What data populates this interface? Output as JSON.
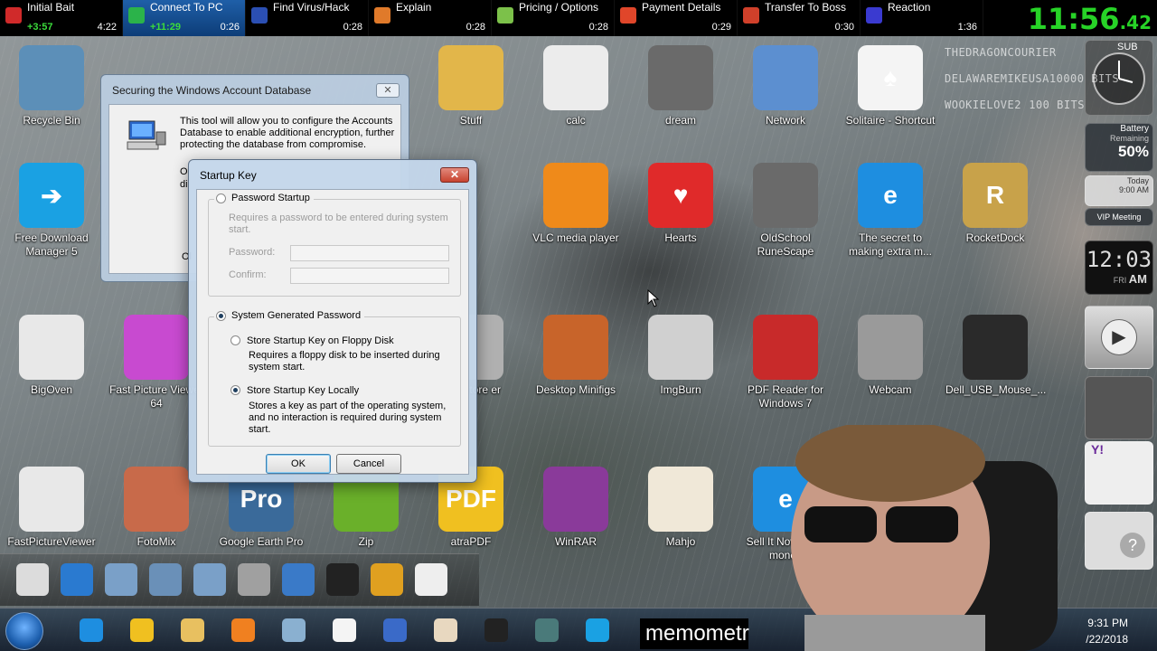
{
  "splits": [
    {
      "name": "Initial Bait",
      "delta": "+3:57",
      "time": "4:22",
      "color": "#d02a2a",
      "active": false
    },
    {
      "name": "Connect To PC",
      "delta": "+11:29",
      "time": "0:26",
      "color": "#2bb34a",
      "active": true
    },
    {
      "name": "Find Virus/Hack",
      "delta": "",
      "time": "0:28",
      "color": "#2b4fb3",
      "active": false
    },
    {
      "name": "Explain",
      "delta": "",
      "time": "0:28",
      "color": "#e07a2a",
      "active": false
    },
    {
      "name": "Pricing / Options",
      "delta": "",
      "time": "0:28",
      "color": "#7cc14a",
      "active": false
    },
    {
      "name": "Payment Details",
      "delta": "",
      "time": "0:29",
      "color": "#e0462a",
      "active": false
    },
    {
      "name": "Transfer To Boss",
      "delta": "",
      "time": "0:30",
      "color": "#d0402a",
      "active": false
    },
    {
      "name": "Reaction",
      "delta": "",
      "time": "1:36",
      "color": "#3a3ad0",
      "active": false
    }
  ],
  "main_timer": {
    "main": "11:56",
    "fraction": ".42"
  },
  "desktop_icons": [
    {
      "label": "Recycle Bin",
      "color": "#5c8fb8",
      "glyph": ""
    },
    {
      "label": "Stuff",
      "color": "#e2b64a",
      "glyph": ""
    },
    {
      "label": "calc",
      "color": "#ececec",
      "glyph": ""
    },
    {
      "label": "dream",
      "color": "#6a6a6a",
      "glyph": ""
    },
    {
      "label": "Network",
      "color": "#5c8fd0",
      "glyph": ""
    },
    {
      "label": "Solitaire - Shortcut",
      "color": "#f4f4f4",
      "glyph": "♠"
    },
    {
      "label": "Free Download Manager 5",
      "color": "#1aa1e3",
      "glyph": "➔"
    },
    {
      "label": "VLC media player",
      "color": "#ef8a1a",
      "glyph": ""
    },
    {
      "label": "Hearts",
      "color": "#e02a2a",
      "glyph": "♥"
    },
    {
      "label": "OldSchool RuneScape",
      "color": "#6a6a6a",
      "glyph": ""
    },
    {
      "label": "The secret to making extra m...",
      "color": "#1e8ee0",
      "glyph": "e"
    },
    {
      "label": "RocketDock",
      "color": "#c8a24a",
      "glyph": "R"
    },
    {
      "label": "BigOven",
      "color": "#e8e8e8",
      "glyph": ""
    },
    {
      "label": "Fast Picture Viewer 64",
      "color": "#c84ad0",
      "glyph": ""
    },
    {
      "label": "d Restore er",
      "color": "#b0b0b0",
      "glyph": ""
    },
    {
      "label": "Desktop Minifigs",
      "color": "#c8642a",
      "glyph": ""
    },
    {
      "label": "ImgBurn",
      "color": "#d0d0d0",
      "glyph": ""
    },
    {
      "label": "PDF Reader for Windows 7",
      "color": "#c82a2a",
      "glyph": ""
    },
    {
      "label": "Webcam",
      "color": "#9a9a9a",
      "glyph": ""
    },
    {
      "label": "Dell_USB_Mouse_...",
      "color": "#2a2a2a",
      "glyph": ""
    },
    {
      "label": "FastPictureViewer",
      "color": "#e8e8e8",
      "glyph": ""
    },
    {
      "label": "FotoMix",
      "color": "#c86a4a",
      "glyph": ""
    },
    {
      "label": "Google Earth Pro",
      "color": "#3a6a9a",
      "glyph": "Pro"
    },
    {
      "label": "Zip",
      "color": "#6ab02a",
      "glyph": ""
    },
    {
      "label": "atraPDF",
      "color": "#f0c020",
      "glyph": "PDF"
    },
    {
      "label": "WinRAR",
      "color": "#8a3a9a",
      "glyph": ""
    },
    {
      "label": "Mahjo",
      "color": "#f0e8d8",
      "glyph": ""
    },
    {
      "label": "Sell It Now! h ke money",
      "color": "#1e8ee0",
      "glyph": "e"
    }
  ],
  "secure_dialog": {
    "title": "Securing the Windows Account Database",
    "close": "✕",
    "description": "This tool will allow you to configure the Accounts Database to enable additional encryption, further protecting the database from compromise.",
    "frag1": "O",
    "frag2": "di",
    "ok_fragment": "Ol"
  },
  "startup_dialog": {
    "title": "Startup Key",
    "close": "✕",
    "password_startup": {
      "label": "Password Startup",
      "selected": false,
      "description": "Requires a password to be entered during system start.",
      "password_label": "Password:",
      "confirm_label": "Confirm:"
    },
    "system_generated": {
      "label": "System Generated Password",
      "selected": true,
      "floppy": {
        "label": "Store Startup Key on Floppy Disk",
        "selected": false,
        "description": "Requires a floppy disk to be inserted during system start."
      },
      "locally": {
        "label": "Store Startup Key Locally",
        "selected": true,
        "description": "Stores a key as part of the operating system, and no interaction is required during system start."
      }
    },
    "ok_label": "OK",
    "cancel_label": "Cancel"
  },
  "chat": [
    {
      "user": "THEDRAGONCOURIER",
      "amount": ""
    },
    {
      "user": "DELAWAREMIKEUSA",
      "amount": "10000 BITS"
    },
    {
      "user": "WOOKIELOVE2",
      "amount": "100 BITS"
    }
  ],
  "sub_tag": "SUB",
  "widgets": {
    "battery_button": "Battery",
    "battery_label": "Battery",
    "battery_remaining": "Remaining",
    "battery_percent": "50%",
    "today_label": "Today",
    "today_time": "9:00 AM",
    "meeting": "VIP Meeting",
    "clock_time": "12:03",
    "clock_day": "FRI",
    "clock_ampm": "AM"
  },
  "taskbar": {
    "tray_time": "9:31 PM",
    "tray_date": "/22/2018",
    "items": [
      "ie",
      "pdf",
      "explorer",
      "media",
      "folder",
      "cards",
      "search",
      "mahjong",
      "dell",
      "app",
      "skype"
    ]
  },
  "memometer": "memometr"
}
